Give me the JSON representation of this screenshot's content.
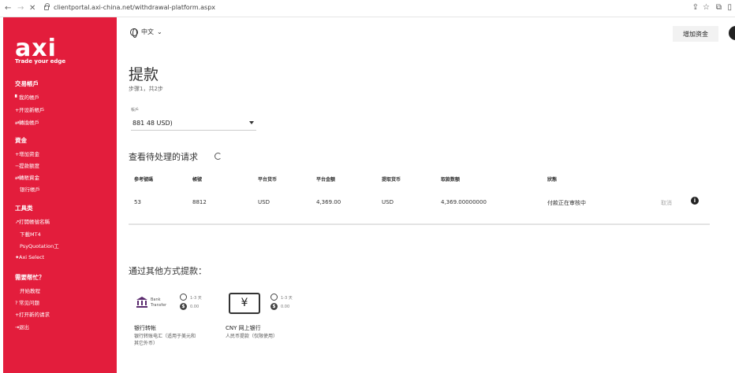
{
  "browser": {
    "url": "clientportal.axi-china.net/withdrawal-platform.aspx",
    "back_icon": "←",
    "forward_icon": "→",
    "close_icon": "✕",
    "share_icon": "⇪",
    "star_icon": "☆",
    "ext_icon": "⧉",
    "sidebar_icon": "▯"
  },
  "sidebar": {
    "logo": "axi",
    "tagline": "Trade your edge",
    "sections": [
      {
        "title": "交易帳戶",
        "items": [
          "我的帳戶",
          "开设新帳戶",
          "轉換帳戶"
        ]
      },
      {
        "title": "資金",
        "items": [
          "增加资金",
          "提款额度",
          "轉賬資金",
          "银行帳戶"
        ]
      },
      {
        "title": "工具类",
        "items": [
          "打開帳號名稱",
          "下載MT4",
          "PsyQuotation工",
          "Axi Select"
        ]
      },
      {
        "title": "需要帮忙？",
        "items": [
          "开始教程",
          "常见问题",
          "打开新的请求",
          "退出"
        ]
      }
    ]
  },
  "header": {
    "language": "中文",
    "deposit_button": "增加资金"
  },
  "page": {
    "title": "提款",
    "step": "步骤1，共2步",
    "account_label": "帳戶",
    "account_value": "881          48 USD)"
  },
  "pending": {
    "title": "查看待处理的请求",
    "columns": [
      "参考號碼",
      "帳號",
      "平台货币",
      "平台金额",
      "提取货币",
      "取款数额",
      "狀態"
    ],
    "row": {
      "ref": "53",
      "account": "8812",
      "platform_currency": "USD",
      "platform_amount": "4,369.00",
      "withdraw_currency": "USD",
      "withdraw_amount": "4,369.00000000",
      "status": "付款正在审核中",
      "cancel": "取消"
    }
  },
  "other_methods": {
    "title": "通过其他方式提款：",
    "methods": [
      {
        "icon_text": "Bank\nTransfer",
        "time": "1-3 天",
        "fee": "0.00",
        "name": "银行转帐",
        "desc": "银行转账电汇（适用于美元和其它外币）"
      },
      {
        "icon_text": "¥",
        "time": "1-3 天",
        "fee": "0.00",
        "name": "CNY 网上银行",
        "desc": "人民币提款（仅限使用）"
      }
    ]
  },
  "colors": {
    "sidebar": "#e31d3c",
    "accent_button_bg": "#f2f2f2"
  }
}
